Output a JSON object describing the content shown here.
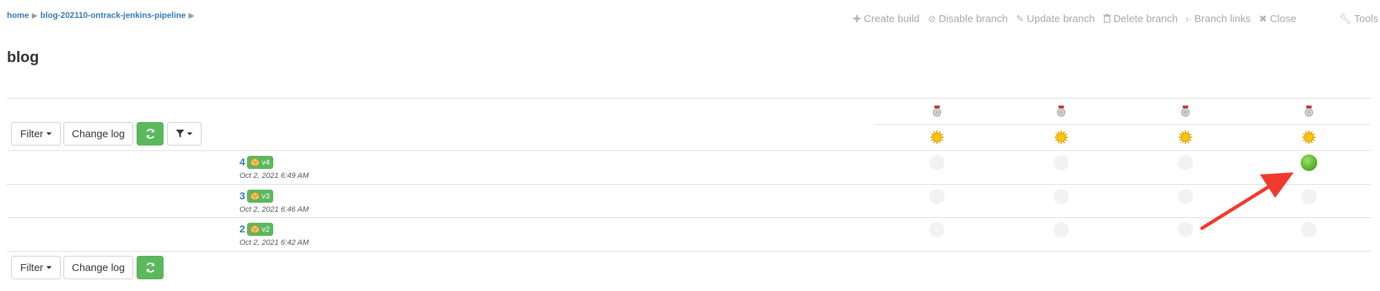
{
  "breadcrumb": {
    "items": [
      "home",
      "blog-202110-ontrack-jenkins-pipeline"
    ]
  },
  "actions": [
    {
      "label": "Create build",
      "icon": "plus-icon"
    },
    {
      "label": "Disable branch",
      "icon": "ban-icon"
    },
    {
      "label": "Update branch",
      "icon": "pencil-icon"
    },
    {
      "label": "Delete branch",
      "icon": "trash-icon"
    },
    {
      "label": "Branch links",
      "icon": "branch-links-icon"
    },
    {
      "label": "Close",
      "icon": "close-icon"
    }
  ],
  "tools": {
    "label": "Tools",
    "icon": "wrench-icon"
  },
  "page": {
    "title": "blog"
  },
  "toolbar": {
    "filter_label": "Filter",
    "changelog_label": "Change log"
  },
  "columns": {
    "count": 4,
    "header_icons": [
      "medal-icon",
      "sun-icon"
    ]
  },
  "builds": [
    {
      "number": "4",
      "label": "v4",
      "date": "Oct 2, 2021 6:49 AM",
      "runs": [
        "none",
        "none",
        "none",
        "passed"
      ]
    },
    {
      "number": "3",
      "label": "v3",
      "date": "Oct 2, 2021 6:46 AM",
      "runs": [
        "none",
        "none",
        "none",
        "none"
      ]
    },
    {
      "number": "2",
      "label": "v2",
      "date": "Oct 2, 2021 6:42 AM",
      "runs": [
        "none",
        "none",
        "none",
        "none"
      ]
    }
  ],
  "colors": {
    "link": "#337ab7",
    "success": "#5cb85c",
    "annotation_arrow": "#f03a2e",
    "muted": "#a8a8a8"
  }
}
